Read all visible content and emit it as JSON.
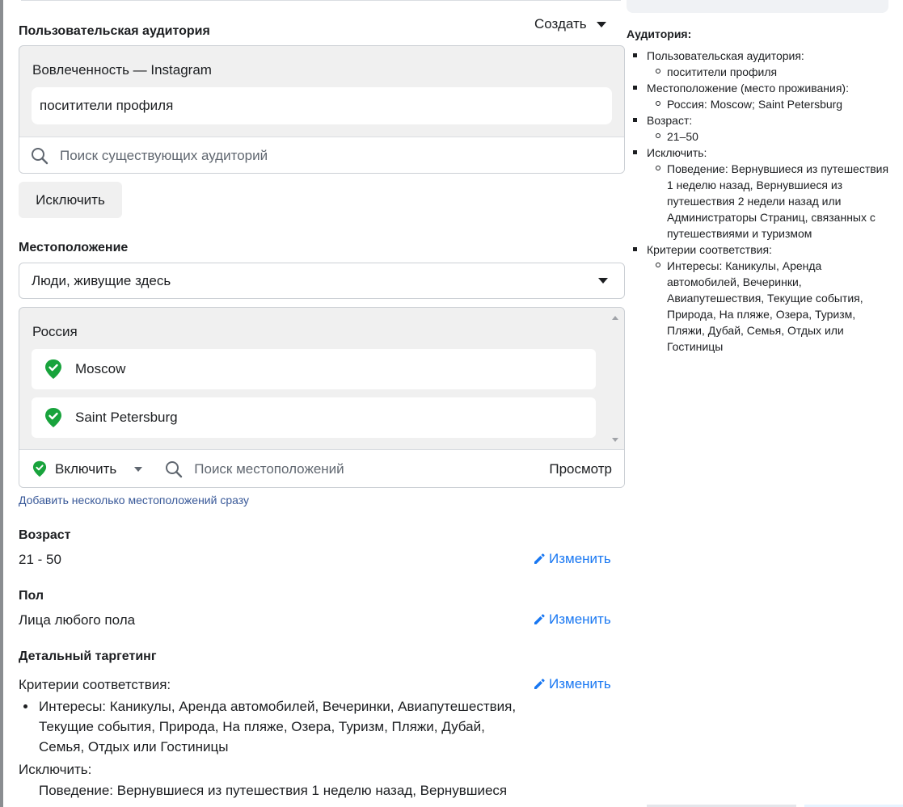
{
  "custom_audience": {
    "title": "Пользовательская аудитория",
    "create_label": "Создать",
    "group_label": "Вовлеченность — Instagram",
    "selected": "поситители профиля",
    "search_placeholder": "Поиск существующих аудиторий",
    "exclude_label": "Исключить"
  },
  "location": {
    "title": "Местоположение",
    "selector_value": "Люди, живущие здесь",
    "country": "Россия",
    "items": [
      {
        "name": "Moscow"
      },
      {
        "name": "Saint Petersburg"
      }
    ],
    "include_label": "Включить",
    "search_placeholder": "Поиск местоположений",
    "preview_label": "Просмотр",
    "add_multiple_link": "Добавить несколько местоположений сразу"
  },
  "age": {
    "title": "Возраст",
    "value": "21 - 50",
    "edit_label": "Изменить"
  },
  "gender": {
    "title": "Пол",
    "value": "Лица любого пола",
    "edit_label": "Изменить"
  },
  "detailed": {
    "title": "Детальный таргетинг",
    "criteria_label": "Критерии соответствия:",
    "edit_label": "Изменить",
    "interests": "Интересы: Каникулы, Аренда автомобилей, Вечеринки, Авиапутешествия, Текущие события, Природа, На пляже, Озера, Туризм, Пляжи, Дубай, Семья, Отдых или Гостиницы",
    "exclude_label": "Исключить:",
    "behaviour": "Поведение: Вернувшиеся из путешествия 1 неделю назад, Вернувшиеся"
  },
  "summary": {
    "title": "Аудитория:",
    "sections": [
      {
        "label": "Пользовательская аудитория:",
        "items": [
          "поситители профиля"
        ]
      },
      {
        "label": "Местоположение (место проживания):",
        "items": [
          "Россия: Moscow; Saint Petersburg"
        ]
      },
      {
        "label": "Возраст:",
        "items": [
          "21–50"
        ]
      },
      {
        "label": "Исключить:",
        "items": [
          "Поведение: Вернувшиеся из путешествия 1 неделю назад, Вернувшиеся из путешествия 2 недели назад или Администраторы Страниц, связанных с путешествиями и туризмом"
        ]
      },
      {
        "label": "Критерии соответствия:",
        "items": [
          "Интересы: Каникулы, Аренда автомобилей, Вечеринки, Авиапутешествия, Текущие события, Природа, На пляже, Озера, Туризм, Пляжи, Дубай, Семья, Отдых или Гостиницы"
        ]
      }
    ]
  },
  "colors": {
    "accent_blue": "#1877f2",
    "link_blue": "#385898",
    "check_green": "#18a33c"
  }
}
